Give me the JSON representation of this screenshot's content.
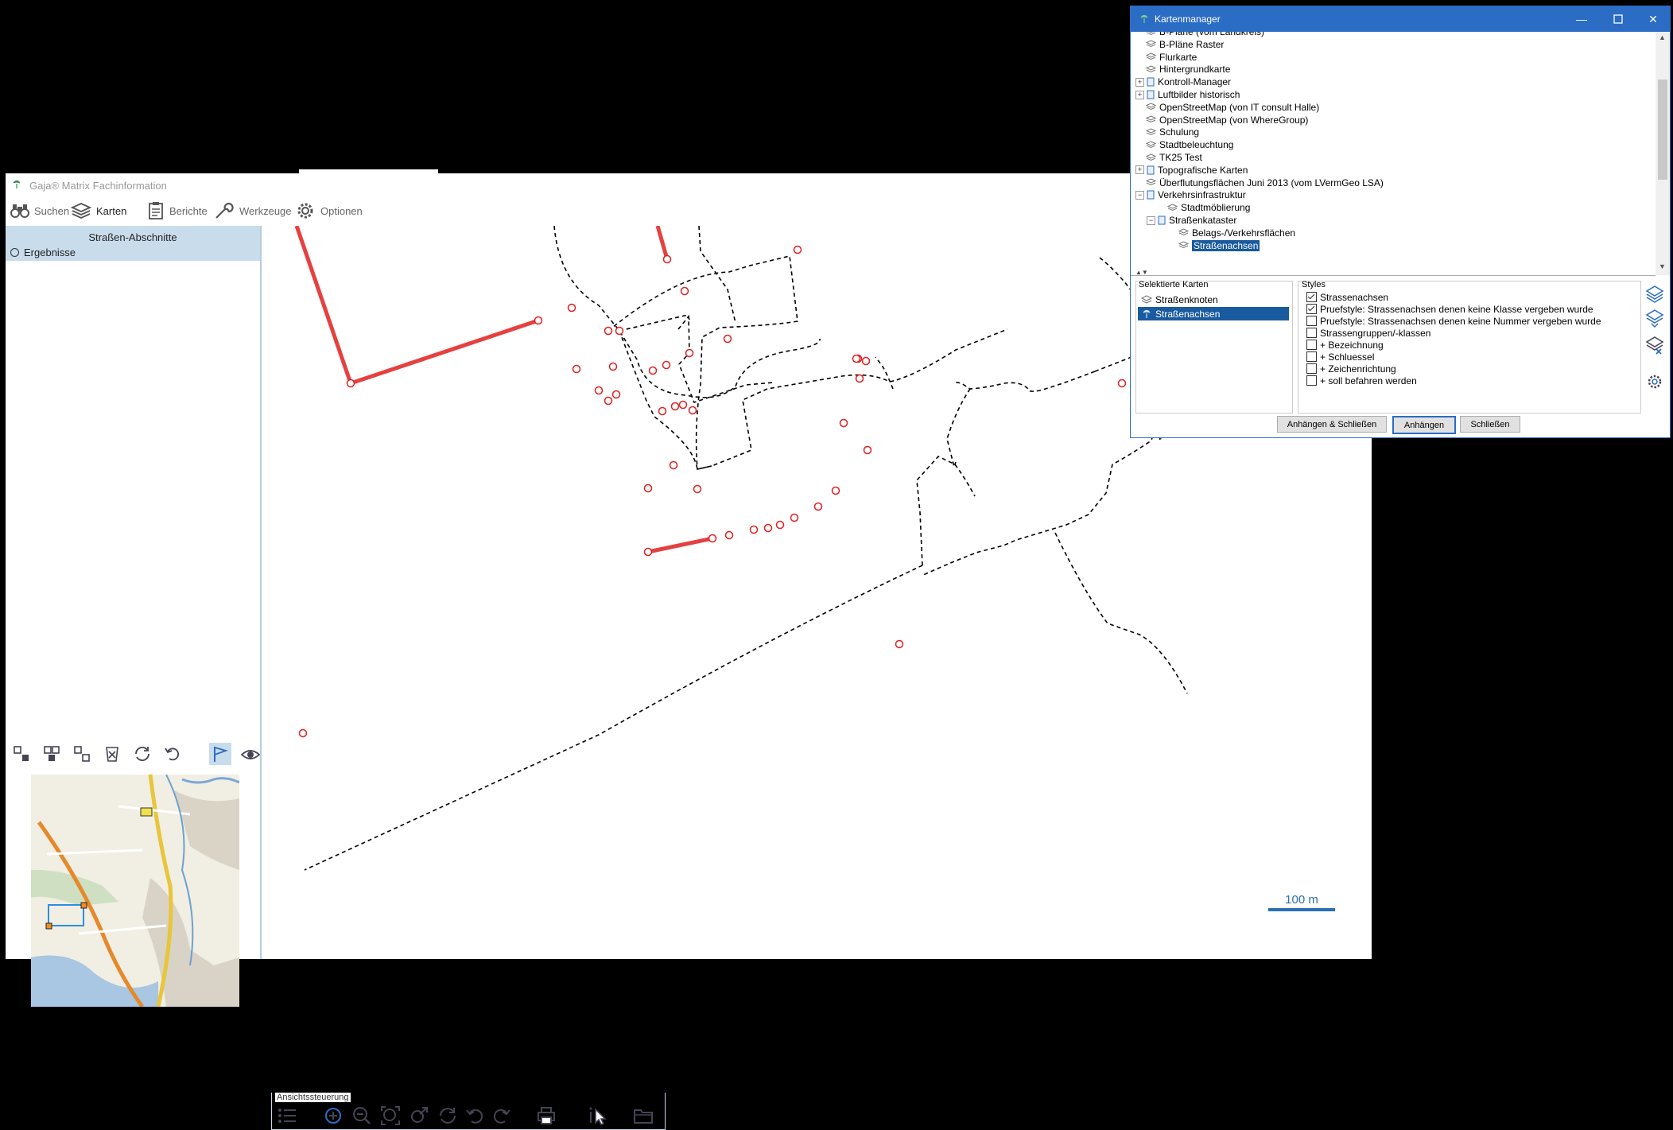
{
  "main_window": {
    "title": "Gaja® Matrix Fachinformation",
    "toolbar": [
      {
        "icon": "binoculars-icon",
        "label": "Suchen"
      },
      {
        "icon": "layers-icon",
        "label": "Karten"
      },
      {
        "icon": "clipboard-icon",
        "label": "Berichte"
      },
      {
        "icon": "wrench-icon",
        "label": "Werkzeuge"
      },
      {
        "icon": "gear-icon",
        "label": "Optionen"
      }
    ]
  },
  "left_panel": {
    "header": "Straßen-Abschnitte",
    "result_option": "Ergebnisse"
  },
  "map": {
    "scale_label": "100 m",
    "view_control_label": "Ansichtssteuerung",
    "colors": {
      "accent": "#2a6fb3",
      "selected_line": "#e02020",
      "node": "#e02020",
      "line": "#000000"
    }
  },
  "dialog": {
    "title": "Kartenmanager",
    "tree": [
      {
        "label": "B-Pläne (vom Landkreis)",
        "level": 0,
        "expander": ""
      },
      {
        "label": "B-Pläne Raster",
        "level": 0,
        "expander": ""
      },
      {
        "label": "Flurkarte",
        "level": 0,
        "expander": ""
      },
      {
        "label": "Hintergrundkarte",
        "level": 0,
        "expander": ""
      },
      {
        "label": "Kontroll-Manager",
        "level": 0,
        "expander": "+"
      },
      {
        "label": "Luftbilder historisch",
        "level": 0,
        "expander": "+"
      },
      {
        "label": "OpenStreetMap (von IT consult Halle)",
        "level": 0,
        "expander": ""
      },
      {
        "label": "OpenStreetMap (von WhereGroup)",
        "level": 0,
        "expander": ""
      },
      {
        "label": "Schulung",
        "level": 0,
        "expander": ""
      },
      {
        "label": "Stadtbeleuchtung",
        "level": 0,
        "expander": ""
      },
      {
        "label": "TK25 Test",
        "level": 0,
        "expander": ""
      },
      {
        "label": "Topografische Karten",
        "level": 0,
        "expander": "+"
      },
      {
        "label": "Überflutungsflächen Juni 2013 (vom LVermGeo LSA)",
        "level": 0,
        "expander": ""
      },
      {
        "label": "Verkehrsinfrastruktur",
        "level": 0,
        "expander": "−"
      },
      {
        "label": "Stadtmöblierung",
        "level": 1,
        "expander": ""
      },
      {
        "label": "Straßenkataster",
        "level": 1,
        "expander": "−"
      },
      {
        "label": "Belags-/Verkehrsflächen",
        "level": 2,
        "expander": ""
      },
      {
        "label": "Straßenachsen",
        "level": 2,
        "expander": "",
        "selected": true
      }
    ],
    "selected_maps_label": "Selektierte Karten",
    "selected_maps": [
      {
        "label": "Straßenknoten",
        "selected": false
      },
      {
        "label": "Straßenachsen",
        "selected": true
      }
    ],
    "styles_label": "Styles",
    "styles": [
      {
        "label": "Strassenachsen",
        "checked": true
      },
      {
        "label": "Pruefstyle: Strassenachsen denen keine Klasse vergeben wurde",
        "checked": true
      },
      {
        "label": "Pruefstyle: Strassenachsen denen keine Nummer vergeben wurde",
        "checked": false
      },
      {
        "label": "Strassengruppen/-klassen",
        "checked": false
      },
      {
        "label": "+ Bezeichnung",
        "checked": false
      },
      {
        "label": "+ Schluessel",
        "checked": false
      },
      {
        "label": "+ Zeichenrichtung",
        "checked": false
      },
      {
        "label": "+ soll befahren werden",
        "checked": false
      }
    ],
    "buttons": {
      "attach_close": "Anhängen & Schließen",
      "attach": "Anhängen",
      "close": "Schließen"
    }
  }
}
